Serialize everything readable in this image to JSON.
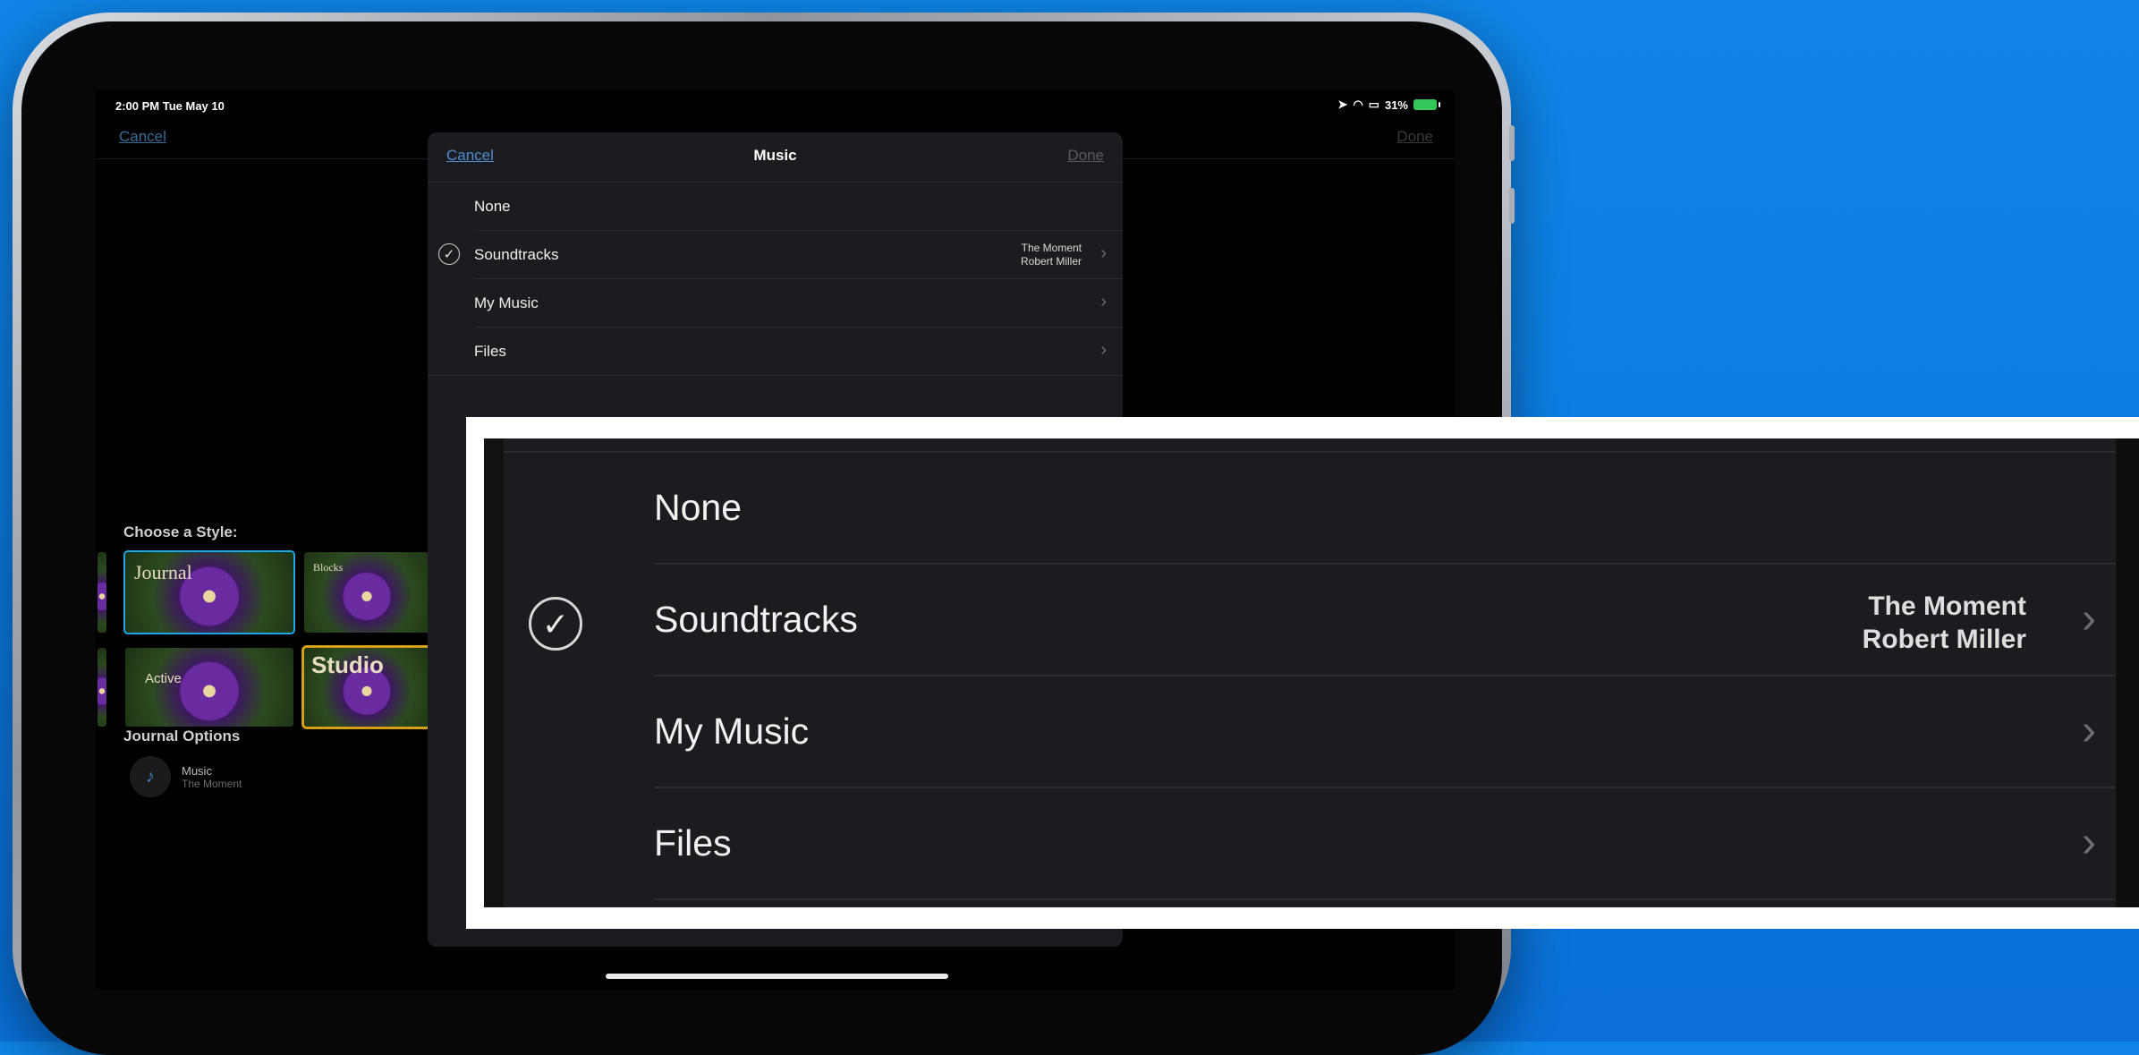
{
  "status": {
    "time": "2:00 PM   Tue May 10",
    "battery": "31%"
  },
  "background": {
    "cancel": "Cancel",
    "done": "Done",
    "choose_style": "Choose a Style:",
    "thumbs": [
      "Journal",
      "Blocks",
      "Active",
      "Studio"
    ],
    "journal_options": "Journal Options",
    "music_label": "Music",
    "music_value": "The Moment"
  },
  "sheet": {
    "cancel": "Cancel",
    "title": "Music",
    "done": "Done",
    "rows": [
      {
        "label": "None"
      },
      {
        "label": "Soundtracks",
        "detail1": "The Moment",
        "detail2": "Robert Miller"
      },
      {
        "label": "My Music"
      },
      {
        "label": "Files"
      }
    ]
  },
  "zoom": {
    "rows": [
      {
        "label": "None"
      },
      {
        "label": "Soundtracks",
        "detail1": "The Moment",
        "detail2": "Robert Miller"
      },
      {
        "label": "My Music"
      },
      {
        "label": "Files"
      }
    ]
  },
  "icons": {
    "check": "checkmark-circle-icon",
    "chevron": "chevron-right-icon",
    "note": "music-note-icon"
  },
  "colors": {
    "backdrop": "#0f84e6",
    "accent": "#4b8ed0",
    "sheet_bg": "#1c1b1f",
    "studio_border": "#d4a017",
    "selected_border": "#1ea6e6"
  }
}
